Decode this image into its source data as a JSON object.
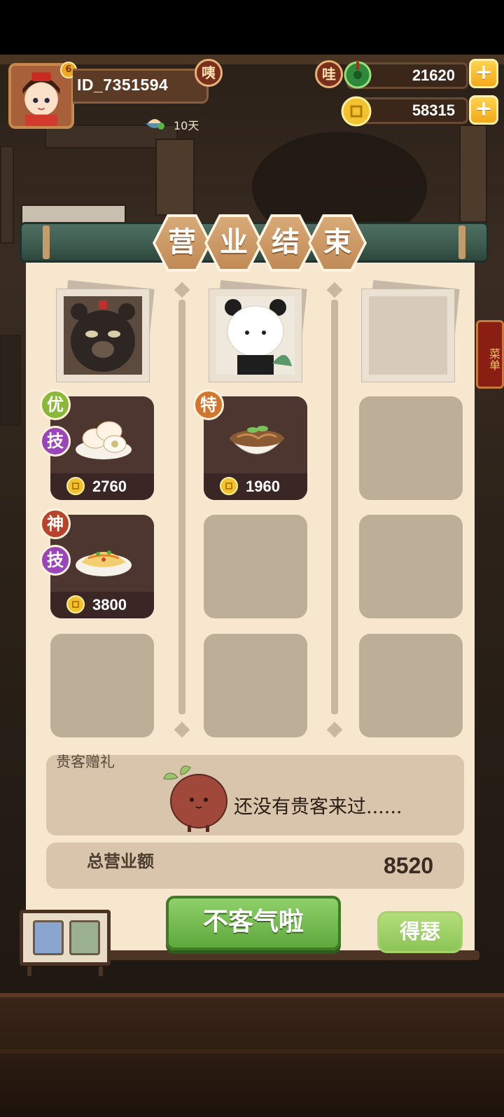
{
  "player": {
    "id": "ID_7351594",
    "badge": "咦",
    "days": "10天"
  },
  "currency": {
    "jade_badge": "哇",
    "jade_value": "21620",
    "coin_value": "58315",
    "plus": "+"
  },
  "side_menu": "菜单",
  "title_chars": [
    "营",
    "业",
    "结",
    "束"
  ],
  "columns": [
    {
      "dishes": [
        {
          "tags": [
            "优",
            "技"
          ],
          "price": "2760"
        },
        {
          "tags": [
            "神",
            "技"
          ],
          "price": "3800"
        }
      ]
    },
    {
      "dishes": [
        {
          "tags": [
            "特"
          ],
          "price": "1960"
        }
      ]
    },
    {
      "dishes": []
    }
  ],
  "vip": {
    "label": "贵客赠礼",
    "empty_message": "还没有贵客来过......"
  },
  "total": {
    "label": "总营业额",
    "value": "8520"
  },
  "buttons": {
    "main": "不客气啦",
    "side": "得瑟"
  },
  "colors": {
    "tag_green": "#8ab83a",
    "tag_purple": "#9a46b8",
    "tag_orange": "#d2762e",
    "tag_red": "#b8432c",
    "main_button": "#6cb848"
  }
}
